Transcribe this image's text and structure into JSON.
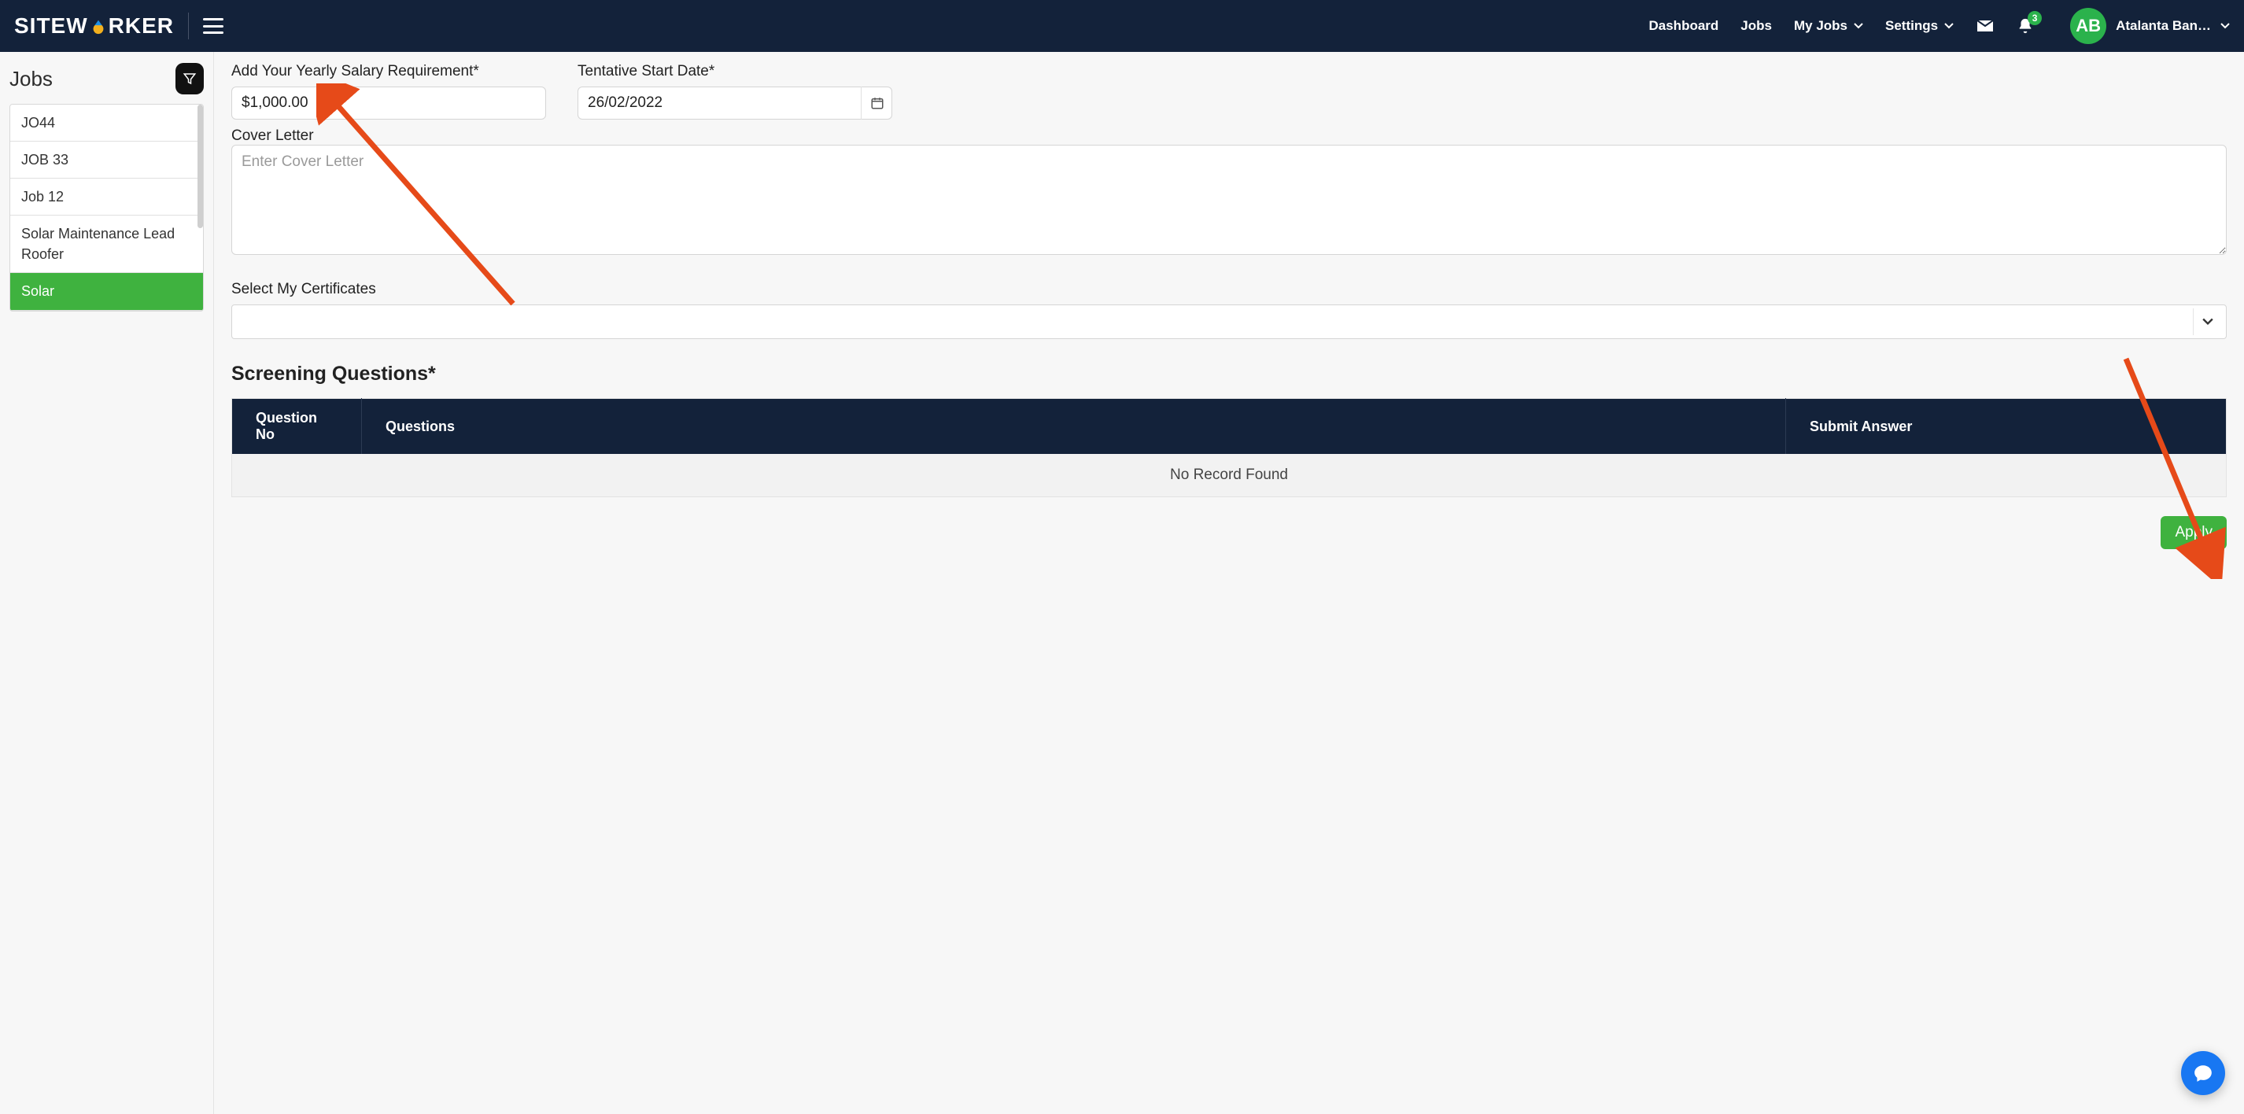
{
  "brand": {
    "name_pre": "SITEW",
    "name_post": "RKER"
  },
  "nav": {
    "dashboard": "Dashboard",
    "jobs": "Jobs",
    "my_jobs": "My Jobs",
    "settings": "Settings",
    "notifications_badge": "3",
    "user_initials": "AB",
    "user_name": "Atalanta Ban…"
  },
  "sidebar": {
    "title": "Jobs",
    "items": [
      {
        "label": "JO44",
        "active": false
      },
      {
        "label": "JOB 33",
        "active": false
      },
      {
        "label": "Job 12",
        "active": false
      },
      {
        "label": "Solar Maintenance Lead Roofer",
        "active": false
      },
      {
        "label": "Solar",
        "active": true
      }
    ]
  },
  "form": {
    "salary_label": "Add Your Yearly Salary Requirement*",
    "salary_value": "$1,000.00",
    "start_date_label": "Tentative Start Date*",
    "start_date_value": "26/02/2022",
    "cover_label": "Cover Letter",
    "cover_placeholder": "Enter Cover Letter",
    "certificates_label": "Select My Certificates",
    "certificates_value": ""
  },
  "screening": {
    "title": "Screening Questions*",
    "columns": {
      "no": "Question No",
      "question": "Questions",
      "answer": "Submit Answer"
    },
    "empty": "No Record Found"
  },
  "actions": {
    "apply": "Apply"
  }
}
